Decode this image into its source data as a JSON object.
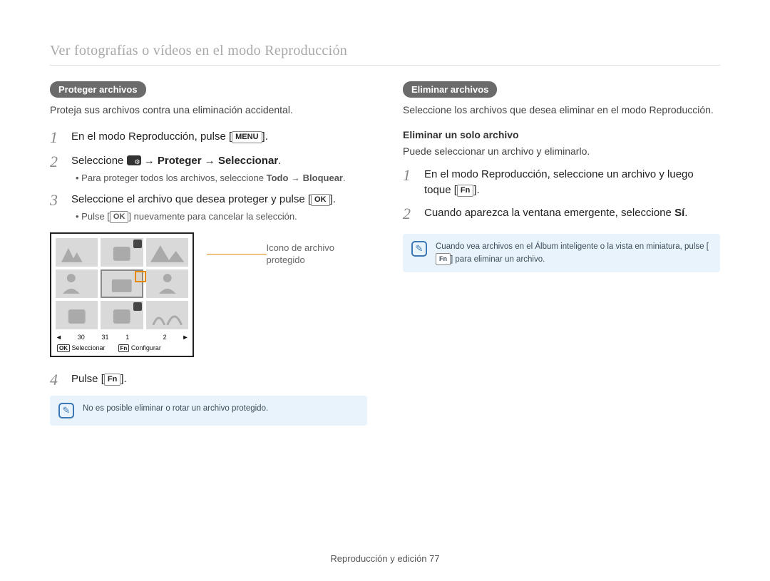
{
  "header": {
    "title": "Ver fotografías o vídeos en el modo Reproducción"
  },
  "left": {
    "label": "Proteger archivos",
    "intro": "Proteja sus archivos contra una eliminación accidental.",
    "steps": {
      "s1": {
        "pre": "En el modo Reproducción, pulse [",
        "btn": "MENU",
        "post": "]."
      },
      "s2": {
        "pre": "Seleccione ",
        "arrow1": " → ",
        "b1": "Proteger",
        "arrow2": " → ",
        "b2": "Seleccionar",
        "post": ".",
        "sub_pre": "Para proteger todos los archivos, seleccione ",
        "sub_b1": "Todo",
        "sub_mid": " → ",
        "sub_b2": "Bloquear",
        "sub_post": "."
      },
      "s3": {
        "pre": "Seleccione el archivo que desea proteger y pulse [",
        "btn": "OK",
        "post": "].",
        "sub_pre": "Pulse [",
        "sub_btn": "OK",
        "sub_post": "] nuevamente para cancelar la selección."
      },
      "s4": {
        "pre": "Pulse [",
        "btn": "Fn",
        "post": "]."
      }
    },
    "callout": "Icono de archivo protegido",
    "lcd": {
      "dates": {
        "d1": "30",
        "d2": "31",
        "d3": "1",
        "d4": "2"
      },
      "footer": {
        "ok": "OK",
        "ok_label": "Seleccionar",
        "fn": "Fn",
        "fn_label": "Configurar"
      }
    },
    "note": "No es posible eliminar o rotar un archivo protegido."
  },
  "right": {
    "label": "Eliminar archivos",
    "intro": "Seleccione los archivos que desea eliminar en el modo Reproducción.",
    "subhead": "Eliminar un solo archivo",
    "subintro": "Puede seleccionar un archivo y eliminarlo.",
    "steps": {
      "s1": {
        "pre1": "En el modo Reproducción, seleccione un archivo y luego toque [",
        "btn": "Fn",
        "post": "]."
      },
      "s2": {
        "pre": "Cuando aparezca la ventana emergente, seleccione ",
        "b1": "Sí",
        "post": "."
      }
    },
    "note_pre": "Cuando vea archivos en el Álbum inteligente o la vista en miniatura, pulse [",
    "note_btn": "Fn",
    "note_post": "] para eliminar un archivo."
  },
  "footer": {
    "text": "Reproducción y edición  77"
  }
}
